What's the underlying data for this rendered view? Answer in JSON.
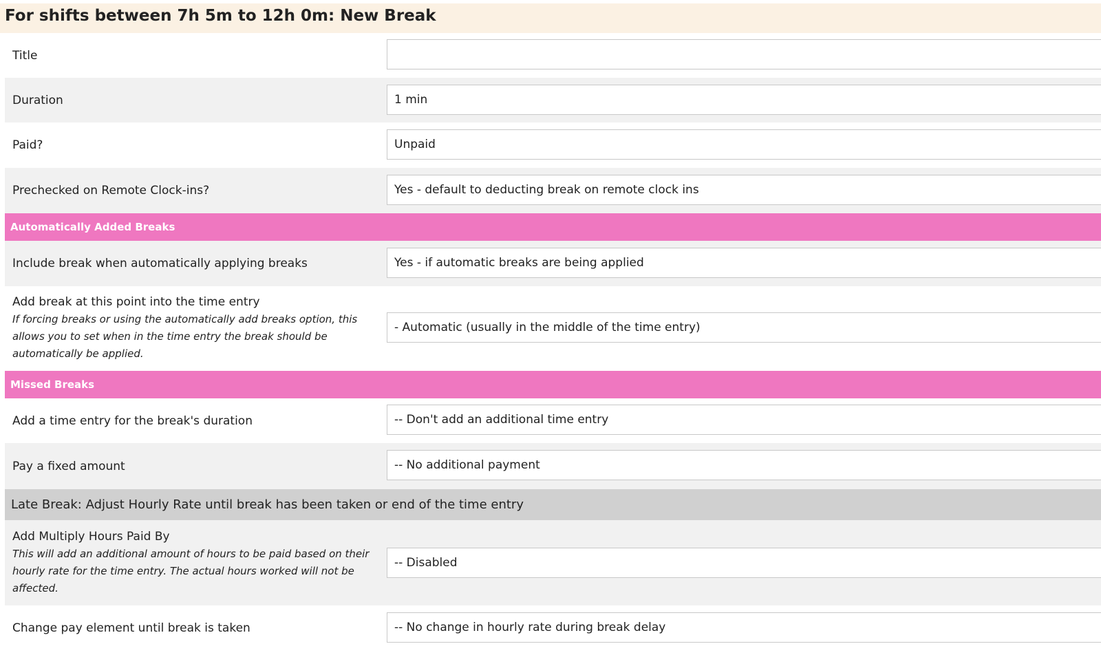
{
  "page": {
    "title": "For shifts between 7h 5m to 12h 0m: New Break"
  },
  "fields": {
    "title": {
      "label": "Title",
      "value": ""
    },
    "duration": {
      "label": "Duration",
      "value": "1 min"
    },
    "paid": {
      "label": "Paid?",
      "value": "Unpaid"
    },
    "prechecked": {
      "label": "Prechecked on Remote Clock-ins?",
      "value": "Yes - default to deducting break on remote clock ins"
    }
  },
  "sections": {
    "auto_breaks": "Automatically Added Breaks",
    "missed_breaks": "Missed Breaks",
    "late_break": "Late Break: Adjust Hourly Rate until break has been taken or end of the time entry"
  },
  "auto_breaks": {
    "include": {
      "label": "Include break when automatically applying breaks",
      "value": "Yes - if automatic breaks are being applied"
    },
    "add_point": {
      "label": "Add break at this point into the time entry",
      "description": "If forcing breaks or using the automatically add breaks option, this allows you to set when in the time entry the break should be automatically be applied.",
      "value": "- Automatic (usually in the middle of the time entry)"
    }
  },
  "missed_breaks": {
    "time_entry": {
      "label": "Add a time entry for the break's duration",
      "value": "-- Don't add an additional time entry"
    },
    "fixed_amount": {
      "label": "Pay a fixed amount",
      "value": "-- No additional payment"
    }
  },
  "late_break": {
    "multiply": {
      "label": "Add Multiply Hours Paid By",
      "description": "This will add an additional amount of hours to be paid based on their hourly rate for the time entry. The actual hours worked will not be affected.",
      "value": "-- Disabled"
    },
    "pay_element": {
      "label": "Change pay element until break is taken",
      "value": "-- No change in hourly rate during break delay"
    }
  }
}
